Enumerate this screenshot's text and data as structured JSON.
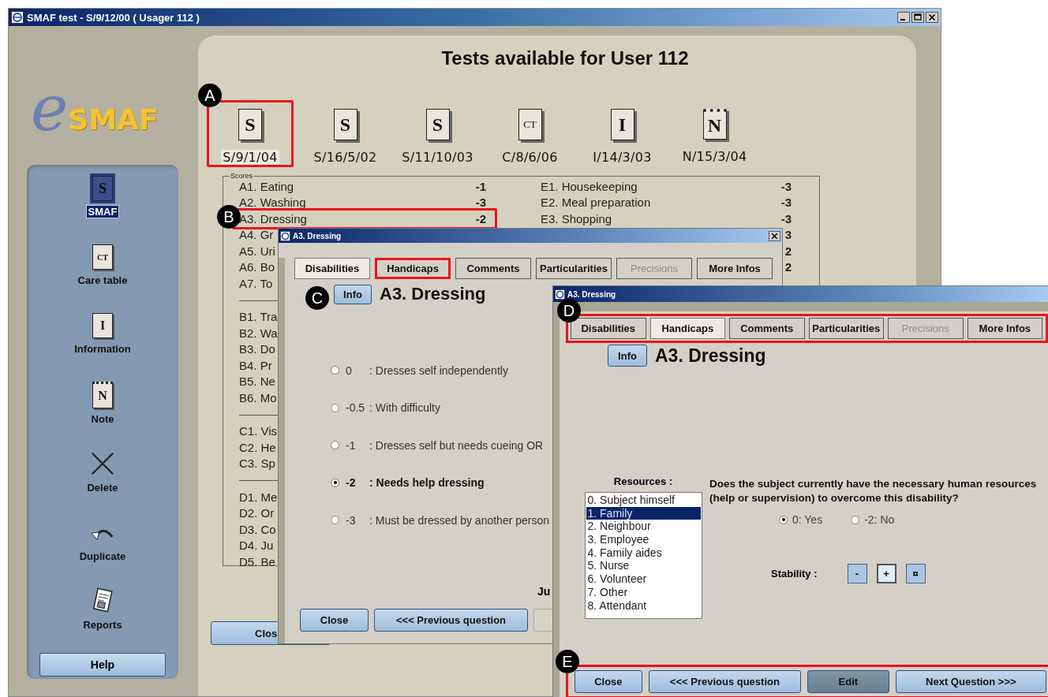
{
  "window": {
    "title": "SMAF test - S/9/12/00 ( Usager 112 )"
  },
  "logo": {
    "prefix": "e",
    "text": "SMAF"
  },
  "sidebar": {
    "items": [
      {
        "kind": "document",
        "glyph": "S",
        "label": "SMAF",
        "selected": true
      },
      {
        "kind": "document",
        "glyph": "CT",
        "label": "Care table",
        "selected": false
      },
      {
        "kind": "document",
        "glyph": "I",
        "label": "Information",
        "selected": false
      },
      {
        "kind": "notebook",
        "glyph": "N",
        "label": "Note",
        "selected": false
      },
      {
        "kind": "delete",
        "label": "Delete",
        "selected": false
      },
      {
        "kind": "duplicate",
        "label": "Duplicate",
        "selected": false
      },
      {
        "kind": "reports",
        "label": "Reports",
        "selected": false
      }
    ],
    "help_button": "Help"
  },
  "main": {
    "title": "Tests available for User 112",
    "tests": [
      {
        "kind": "document",
        "glyph": "S",
        "label": "S/9/1/04",
        "selected": true,
        "highlighted": true,
        "callout": "A"
      },
      {
        "kind": "document",
        "glyph": "S",
        "label": "S/16/5/02",
        "selected": false
      },
      {
        "kind": "document",
        "glyph": "S",
        "label": "S/11/10/03",
        "selected": false
      },
      {
        "kind": "document",
        "glyph": "CT",
        "label": "C/8/6/06",
        "selected": false
      },
      {
        "kind": "document",
        "glyph": "I",
        "label": "I/14/3/03",
        "selected": false
      },
      {
        "kind": "notebook",
        "glyph": "N",
        "label": "N/15/3/04",
        "selected": false
      }
    ],
    "scores": {
      "legend": "Scores",
      "left": [
        {
          "kind": "row",
          "label": "A1. Eating",
          "value": "-1"
        },
        {
          "kind": "row",
          "label": "A2. Washing",
          "value": "-3"
        },
        {
          "kind": "row",
          "label": "A3. Dressing",
          "value": "-2",
          "highlighted": true,
          "callout": "B"
        },
        {
          "kind": "row",
          "label": "A4. Gr"
        },
        {
          "kind": "row",
          "label": "A5. Uri"
        },
        {
          "kind": "row",
          "label": "A6. Bo"
        },
        {
          "kind": "row",
          "label": "A7. To"
        },
        {
          "kind": "separator"
        },
        {
          "kind": "row",
          "label": "B1. Tra"
        },
        {
          "kind": "row",
          "label": "B2. Wa"
        },
        {
          "kind": "row",
          "label": "B3. Do"
        },
        {
          "kind": "row",
          "label": "B4. Pr"
        },
        {
          "kind": "row",
          "label": "B5. Ne"
        },
        {
          "kind": "row",
          "label": "B6. Mo"
        },
        {
          "kind": "separator"
        },
        {
          "kind": "row",
          "label": "C1. Vis"
        },
        {
          "kind": "row",
          "label": "C2. He"
        },
        {
          "kind": "row",
          "label": "C3. Sp"
        },
        {
          "kind": "separator"
        },
        {
          "kind": "row",
          "label": "D1. Me"
        },
        {
          "kind": "row",
          "label": "D2. Or"
        },
        {
          "kind": "row",
          "label": "D3. Co"
        },
        {
          "kind": "row",
          "label": "D4. Ju"
        },
        {
          "kind": "row",
          "label": "D5. Be"
        }
      ],
      "right": [
        {
          "kind": "row",
          "label": "E1. Housekeeping",
          "value": "-3"
        },
        {
          "kind": "row",
          "label": "E2. Meal preparation",
          "value": "-3"
        },
        {
          "kind": "row",
          "label": "E3. Shopping",
          "value": "-3"
        },
        {
          "kind": "value",
          "value": "3"
        },
        {
          "kind": "value",
          "value": "2"
        },
        {
          "kind": "value",
          "value": "2"
        }
      ]
    },
    "close_button": "Clos"
  },
  "dialogs": [
    {
      "title": "A3. Dressing",
      "callout": "C",
      "tabs": [
        {
          "label": "Disabilities",
          "selected": true,
          "disabled": false
        },
        {
          "label": "Handicaps",
          "selected": false,
          "disabled": false,
          "highlighted": true
        },
        {
          "label": "Comments",
          "selected": false,
          "disabled": false
        },
        {
          "label": "Particularities",
          "selected": false,
          "disabled": false
        },
        {
          "label": "Precisions",
          "selected": false,
          "disabled": true
        },
        {
          "label": "More Infos",
          "selected": false,
          "disabled": false
        }
      ],
      "info_button": "Info",
      "heading": "A3. Dressing",
      "options": [
        {
          "value": "0",
          "text": ": Dresses self independently",
          "selected": false
        },
        {
          "value": "-0.5",
          "text": ": With difficulty",
          "selected": false
        },
        {
          "value": "-1",
          "text": ": Dresses self but needs cueing OR",
          "selected": false
        },
        {
          "value": "-2",
          "text": ": Needs help dressing",
          "selected": true
        },
        {
          "value": "-3",
          "text": ": Must be dressed by another person",
          "selected": false
        }
      ],
      "footer_label": "Ju",
      "buttons": [
        {
          "kind": "button",
          "label": "Close"
        },
        {
          "kind": "button",
          "label": "<<< Previous question"
        },
        {
          "kind": "hidden"
        }
      ]
    },
    {
      "title": "A3. Dressing",
      "callout": "D",
      "tab_bar": {
        "highlighted": true
      },
      "tabs": [
        {
          "label": "Disabilities",
          "selected": false,
          "disabled": false
        },
        {
          "label": "Handicaps",
          "selected": true,
          "disabled": false
        },
        {
          "label": "Comments",
          "selected": false,
          "disabled": false
        },
        {
          "label": "Particularities",
          "selected": false,
          "disabled": false
        },
        {
          "label": "Precisions",
          "selected": false,
          "disabled": true
        },
        {
          "label": "More Infos",
          "selected": false,
          "disabled": false
        }
      ],
      "info_button": "Info",
      "heading": "A3. Dressing",
      "resources": {
        "label": "Resources :",
        "items": [
          {
            "label": "0. Subject himself",
            "selected": false
          },
          {
            "label": "1. Family",
            "selected": true
          },
          {
            "label": "2. Neighbour",
            "selected": false
          },
          {
            "label": "3. Employee",
            "selected": false
          },
          {
            "label": "4. Family aides",
            "selected": false
          },
          {
            "label": "5. Nurse",
            "selected": false
          },
          {
            "label": "6. Volunteer",
            "selected": false
          },
          {
            "label": "7. Other",
            "selected": false
          },
          {
            "label": "8. Attendant",
            "selected": false
          }
        ]
      },
      "question": "Does the subject currently have the necessary human resources (help or supervision) to overcome this disability?",
      "answers": [
        {
          "label": "0: Yes",
          "selected": true
        },
        {
          "label": "-2: No",
          "selected": false
        }
      ],
      "stability": {
        "label": "Stability :",
        "buttons": [
          {
            "label": "-",
            "selected": false
          },
          {
            "label": "+",
            "selected": true
          },
          {
            "label": "¤",
            "selected": false
          }
        ]
      },
      "button_bar": {
        "highlighted": true,
        "callout": "E"
      },
      "buttons": [
        {
          "kind": "button",
          "label": "Close"
        },
        {
          "kind": "button",
          "label": "<<< Previous question"
        },
        {
          "kind": "dark",
          "label": "Edit"
        },
        {
          "kind": "button",
          "label": "Next Question >>>"
        }
      ]
    }
  ]
}
